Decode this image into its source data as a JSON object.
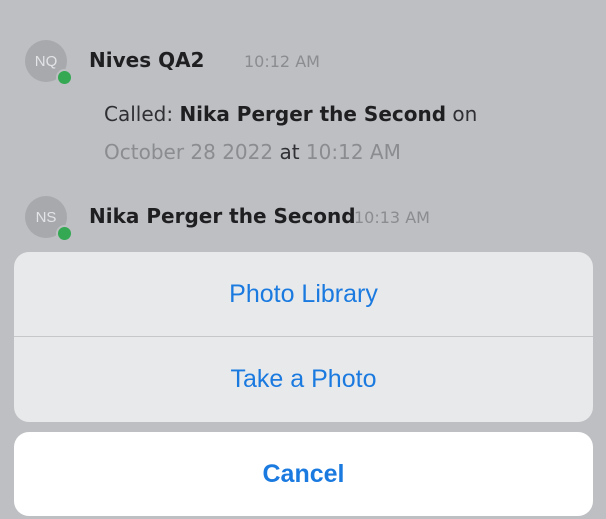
{
  "messages": [
    {
      "avatar_initials": "NQ",
      "author": "Nives QA2",
      "time": "10:12 AM",
      "call": {
        "prefix": "Called: ",
        "callee": "Nika Perger the Second",
        "on_word": " on",
        "date": "October 28 2022",
        "at_word": " at ",
        "call_time": "10:12 AM"
      }
    },
    {
      "avatar_initials": "NS",
      "author": "Nika Perger the Second",
      "time": "10:13 AM"
    }
  ],
  "action_sheet": {
    "options": [
      "Photo Library",
      "Take a Photo"
    ],
    "cancel_label": "Cancel"
  },
  "colors": {
    "accent": "#1a7ae0",
    "presence": "#34a853",
    "dimmed_background": "#bdbfc2"
  }
}
